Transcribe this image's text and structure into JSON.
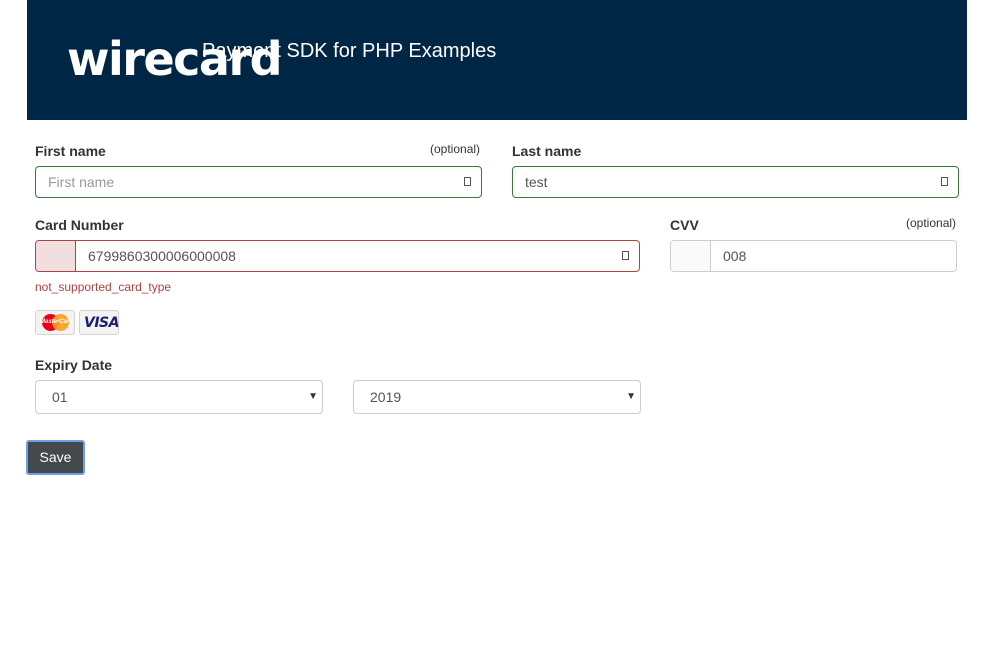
{
  "header": {
    "logo_text": "wirecard",
    "title": "Payment SDK for PHP Examples"
  },
  "form": {
    "first_name": {
      "label": "First name",
      "optional": "(optional)",
      "placeholder": "First name",
      "value": ""
    },
    "last_name": {
      "label": "Last name",
      "value": "test"
    },
    "card_number": {
      "label": "Card Number",
      "value": "6799860300006000008",
      "error": "not_supported_card_type"
    },
    "cvv": {
      "label": "CVV",
      "optional": "(optional)",
      "value": "008"
    },
    "card_logos": [
      "mastercard-logo",
      "visa-logo"
    ],
    "mastercard_text": "MasterCard",
    "visa_text": "VISA",
    "expiry": {
      "label": "Expiry Date",
      "month": "01",
      "year": "2019"
    },
    "save_label": "Save"
  },
  "colors": {
    "header_bg": "#002645",
    "success_border": "#3c763d",
    "error_border": "#a94442",
    "button_bg": "#43484d"
  }
}
